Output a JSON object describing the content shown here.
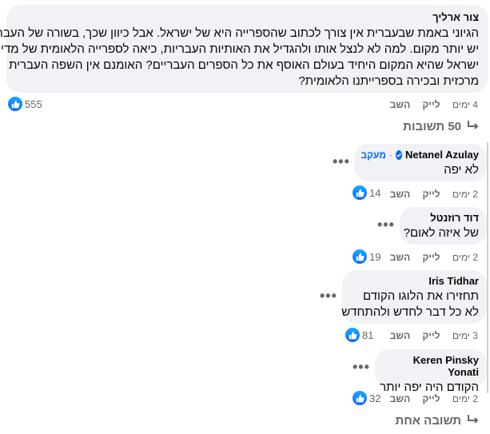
{
  "main_comment": {
    "author": "צור ארליך",
    "lines": [
      "הגיוני באמת שבעברית אין צורך לכתוב שהספרייה היא של ישראל. אבל כיוון שכך, בשורה של העברית",
      "יש יותר מקום. למה לא לנצל אותו ולהגדיל את האותיות העבריות, כיאה לספרייה הלאומית של מדינת",
      "ישראל שהיא המקום היחיד בעולם האוסף את כל הספרים העבריים? האומנם אין השפה העברית",
      "מרכזית ובכירה בספרייתנו הלאומית?"
    ],
    "time": "4 ימים",
    "like_label": "לייק",
    "reply_label": "השב",
    "reactions": "555"
  },
  "replies_toggle": {
    "label": "50 תשובות"
  },
  "replies": [
    {
      "author": "Netanel Azulay",
      "verified": true,
      "follow_label": "מעקב",
      "lines": [
        "לא יפה"
      ],
      "time": "2 ימים",
      "like_label": "לייק",
      "reply_label": "השב",
      "reactions": "14"
    },
    {
      "author": "דוד רוזנטל",
      "lines": [
        "של איזה לאום?"
      ],
      "time": "2 ימים",
      "like_label": "לייק",
      "reply_label": "השב",
      "reactions": "19"
    },
    {
      "author": "Iris Tidhar",
      "lines": [
        "תחזירו את הלוגו הקודם",
        "לא כל דבר לחדש ולהתחדש"
      ],
      "time": "3 ימים",
      "like_label": "לייק",
      "reply_label": "השב",
      "reactions": "81"
    },
    {
      "author": "Keren Pinsky Yonati",
      "lines": [
        "הקודם היה יפה יותר"
      ],
      "time": "2 ימים",
      "like_label": "לייק",
      "reply_label": "השב",
      "reactions": "32"
    }
  ],
  "more_replies": {
    "label": "תשובה אחת"
  },
  "colors": {
    "bubble": "#f0f2f5",
    "link": "#0866ff",
    "meta": "#65676b",
    "thread": "#ccd0d5"
  },
  "icons": {
    "like": "thumbs-up-icon",
    "more": "more-horizontal-icon",
    "reply_arrow": "reply-arrow-icon",
    "verified": "verified-badge-icon"
  }
}
